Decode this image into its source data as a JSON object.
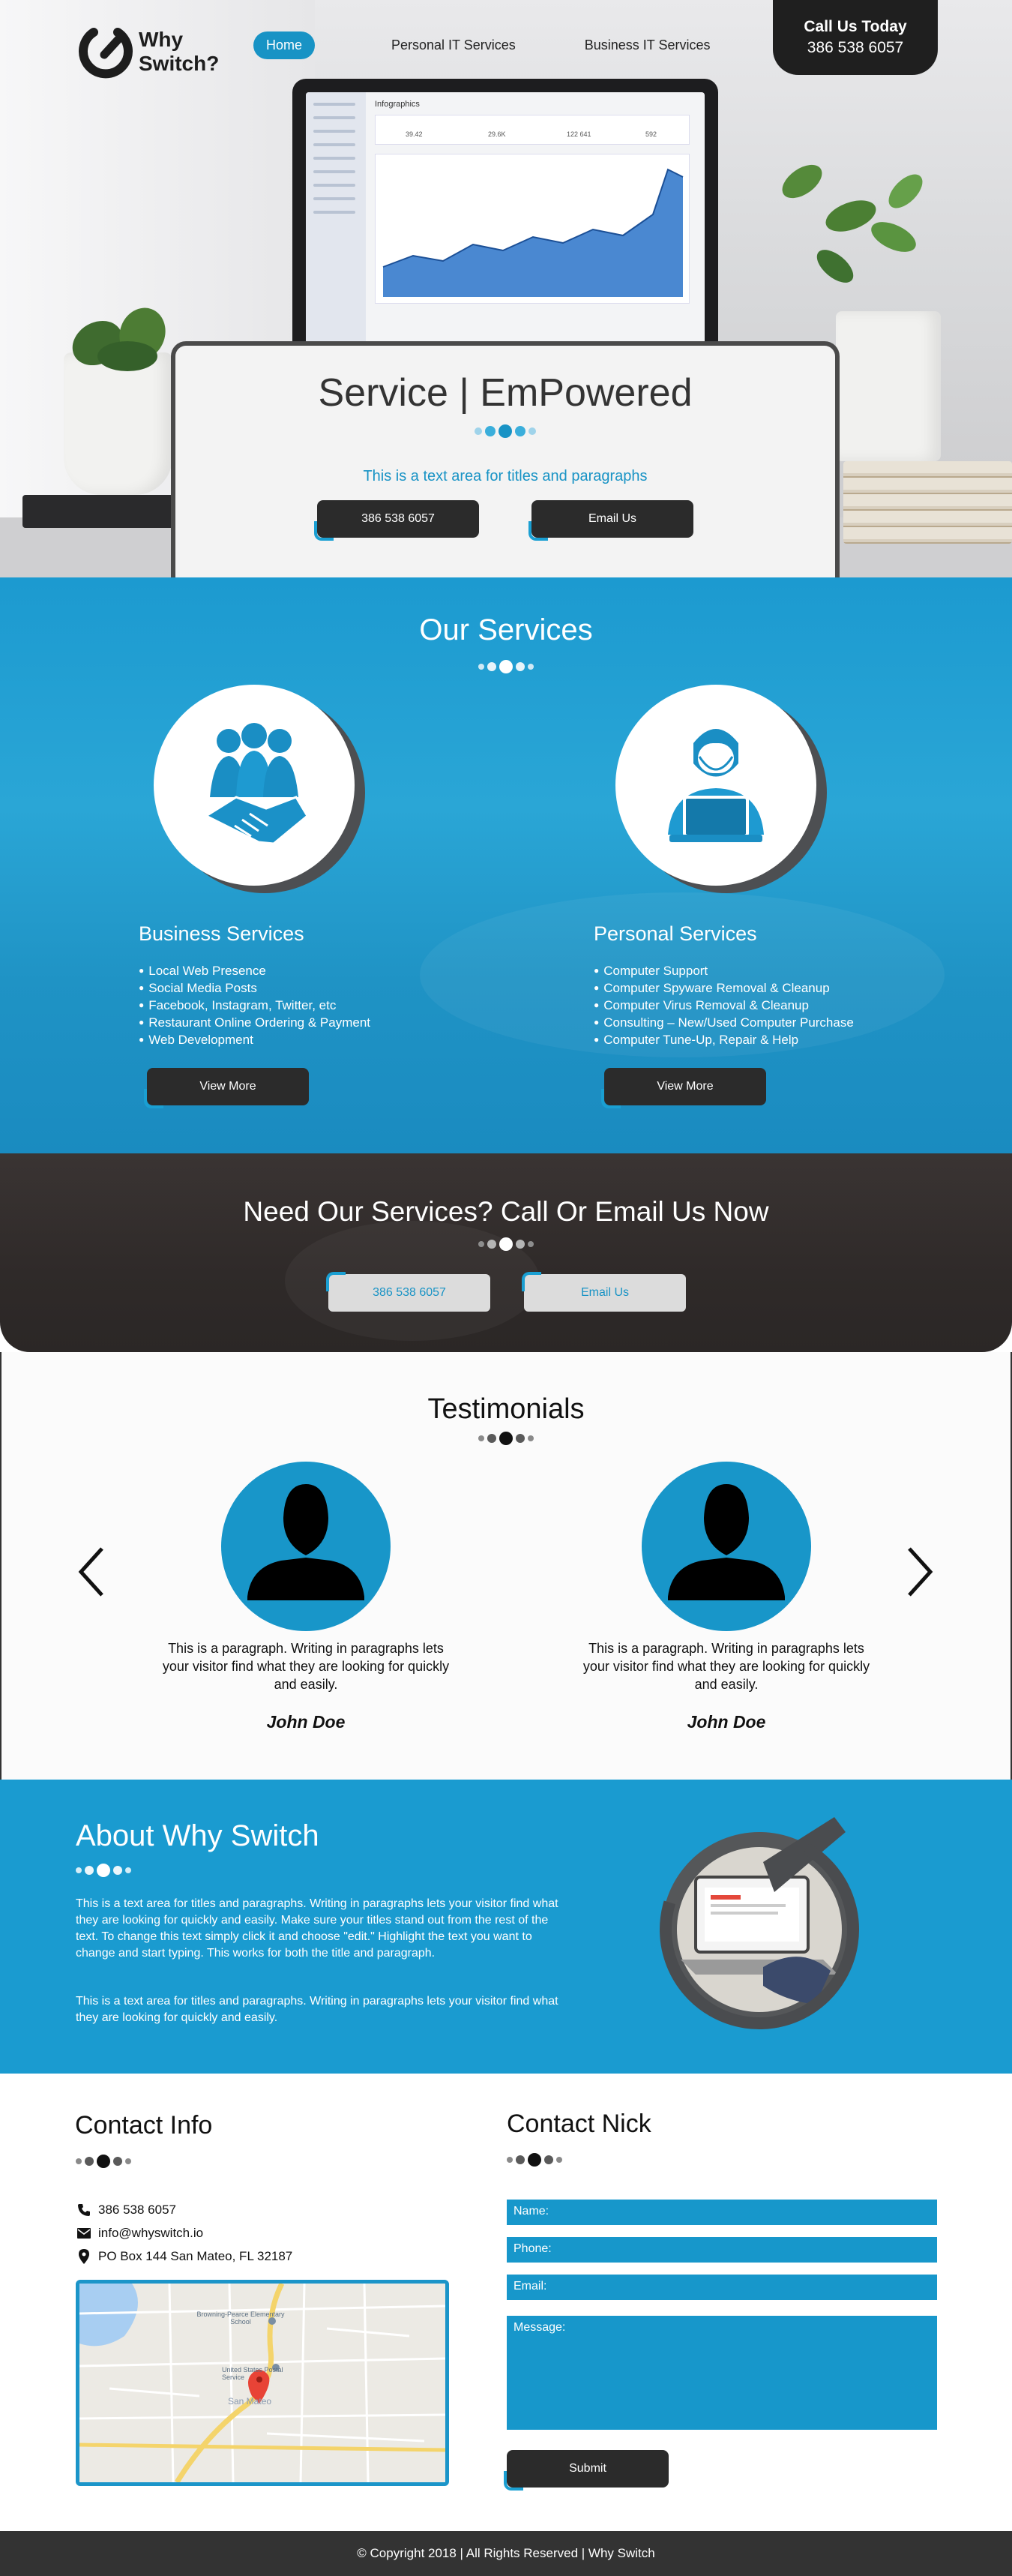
{
  "brand": {
    "name_line1": "Why",
    "name_line2": "Switch?"
  },
  "nav": {
    "items": [
      {
        "label": "Home"
      },
      {
        "label": "Personal IT Services"
      },
      {
        "label": "Business IT Services"
      }
    ]
  },
  "call_badge": {
    "title": "Call Us Today",
    "phone": "386 538 6057"
  },
  "hero": {
    "laptop_screen_title": "Infographics",
    "laptop_stats": [
      "39.42",
      "29.6K",
      "122 641",
      "592"
    ],
    "title": "Service | EmPowered",
    "subtitle": "This is a text area for titles and paragraphs",
    "phone_button": "386 538 6057",
    "email_button": "Email Us"
  },
  "services": {
    "title": "Our Services",
    "business": {
      "name": "Business Services",
      "items": [
        "Local Web Presence",
        "Social Media Posts",
        "Facebook, Instagram, Twitter, etc",
        "Restaurant Online Ordering & Payment",
        "Web Development"
      ],
      "button": "View More",
      "icon": "handshake-icon"
    },
    "personal": {
      "name": "Personal Services",
      "items": [
        "Computer Support",
        "Computer Spyware Removal & Cleanup",
        "Computer Virus Removal & Cleanup",
        "Consulting – New/Used Computer Purchase",
        "Computer Tune-Up, Repair & Help"
      ],
      "button": "View More",
      "icon": "laptop-user-icon"
    }
  },
  "cta": {
    "title": "Need Our Services? Call Or Email Us Now",
    "phone_button": "386 538 6057",
    "email_button": "Email Us"
  },
  "testimonials": {
    "title": "Testimonials",
    "items": [
      {
        "text": "This is a paragraph. Writing in paragraphs lets your visitor find what they are looking for quickly and easily.",
        "name": "John Doe"
      },
      {
        "text": "This is a paragraph. Writing in paragraphs lets your visitor find what they are looking for quickly and easily.",
        "name": "John Doe"
      }
    ]
  },
  "about": {
    "title": "About Why Switch",
    "p1": "This is a text area for titles and paragraphs. Writing in paragraphs lets your visitor find what they are looking for quickly and easily. Make sure your titles stand out from the rest of the text. To change this text simply click it and choose \"edit.\" Highlight the text you want to change and start typing. This works for both the title and paragraph.",
    "p2": "This is a text area for titles and paragraphs. Writing in paragraphs lets your visitor find what they are looking for quickly and easily."
  },
  "contact_info": {
    "title": "Contact Info",
    "phone": "386 538 6057",
    "email": "info@whyswitch.io",
    "address": "PO Box 144 San Mateo, FL 32187",
    "map_labels": {
      "school": "Browning-Pearce Elementary School",
      "post_office": "United States Postal Service",
      "city": "San Mateo"
    }
  },
  "contact_form": {
    "title": "Contact Nick",
    "name_label": "Name:",
    "phone_label": "Phone:",
    "email_label": "Email:",
    "message_label": "Message:",
    "submit": "Submit"
  },
  "footer": {
    "text": "© Copyright 2018 | All Rights Reserved | Why Switch"
  },
  "colors": {
    "accent": "#1893c5",
    "dark": "#2b2b2b",
    "cta_bg": "#332e2d",
    "footer_bg": "#333333"
  }
}
